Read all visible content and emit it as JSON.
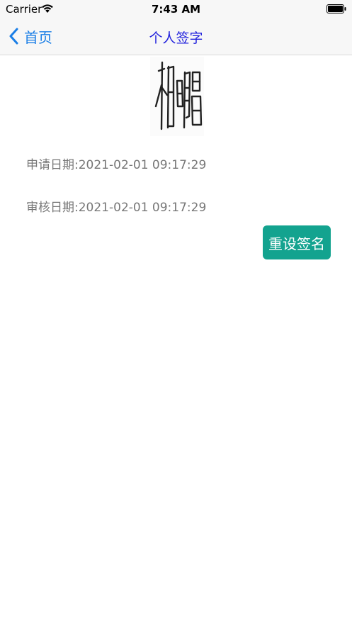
{
  "status_bar": {
    "carrier": "Carrier",
    "time": "7:43 AM"
  },
  "nav": {
    "back_label": "首页",
    "title": "个人签字",
    "accent_color": "#1a7ee6",
    "title_color": "#2222dd"
  },
  "signature": {
    "handwritten_text": "柏明昌"
  },
  "details": {
    "apply_date": "申请日期:2021-02-01 09:17:29",
    "review_date": "审核日期:2021-02-01 09:17:29"
  },
  "actions": {
    "reset_label": "重设签名",
    "reset_color": "#13a38f"
  }
}
